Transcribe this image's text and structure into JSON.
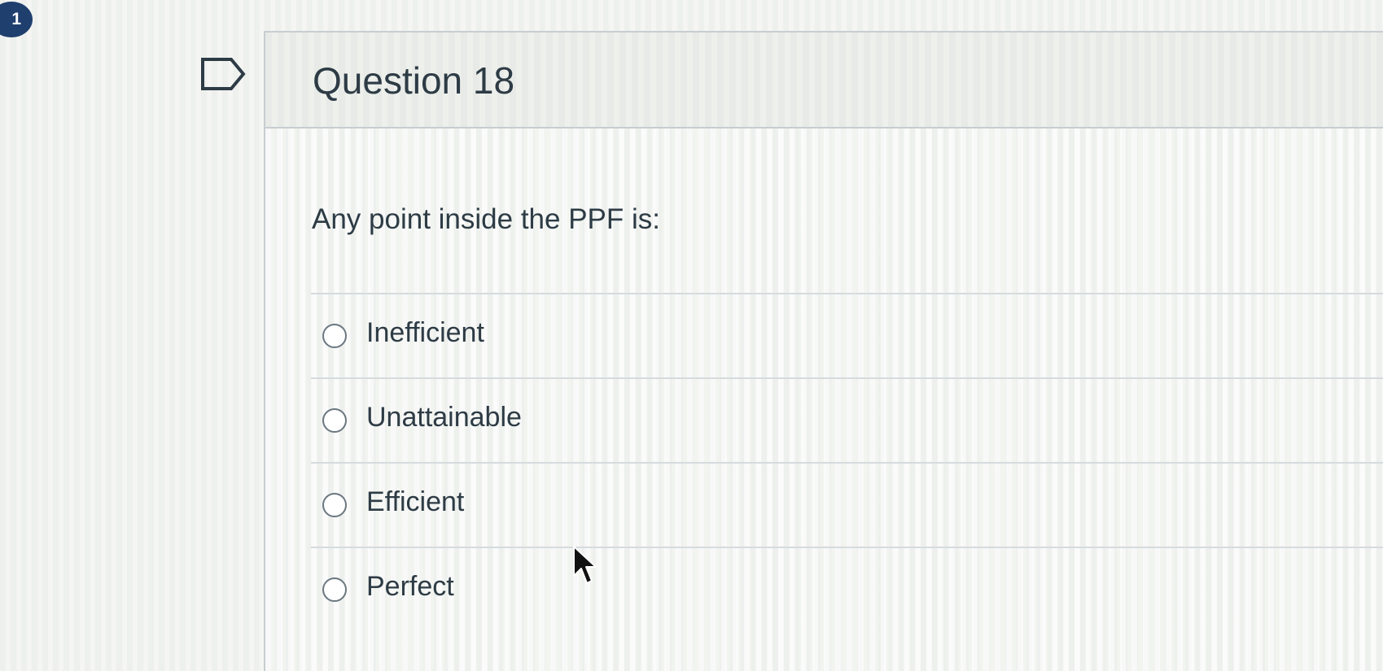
{
  "page_number": "1",
  "question": {
    "title": "Question 18",
    "text": "Any point inside the PPF is:",
    "answers": [
      {
        "label": "Inefficient",
        "selected": false
      },
      {
        "label": "Unattainable",
        "selected": false
      },
      {
        "label": "Efficient",
        "selected": false
      },
      {
        "label": "Perfect",
        "selected": false
      }
    ]
  },
  "icons": {
    "flag": "flag-question-icon",
    "radio": "radio-unselected-icon",
    "cursor": "mouse-pointer-icon"
  },
  "colors": {
    "page_badge": "#1f3f6e",
    "text": "#2d3b45",
    "border": "#c7cdd1"
  }
}
